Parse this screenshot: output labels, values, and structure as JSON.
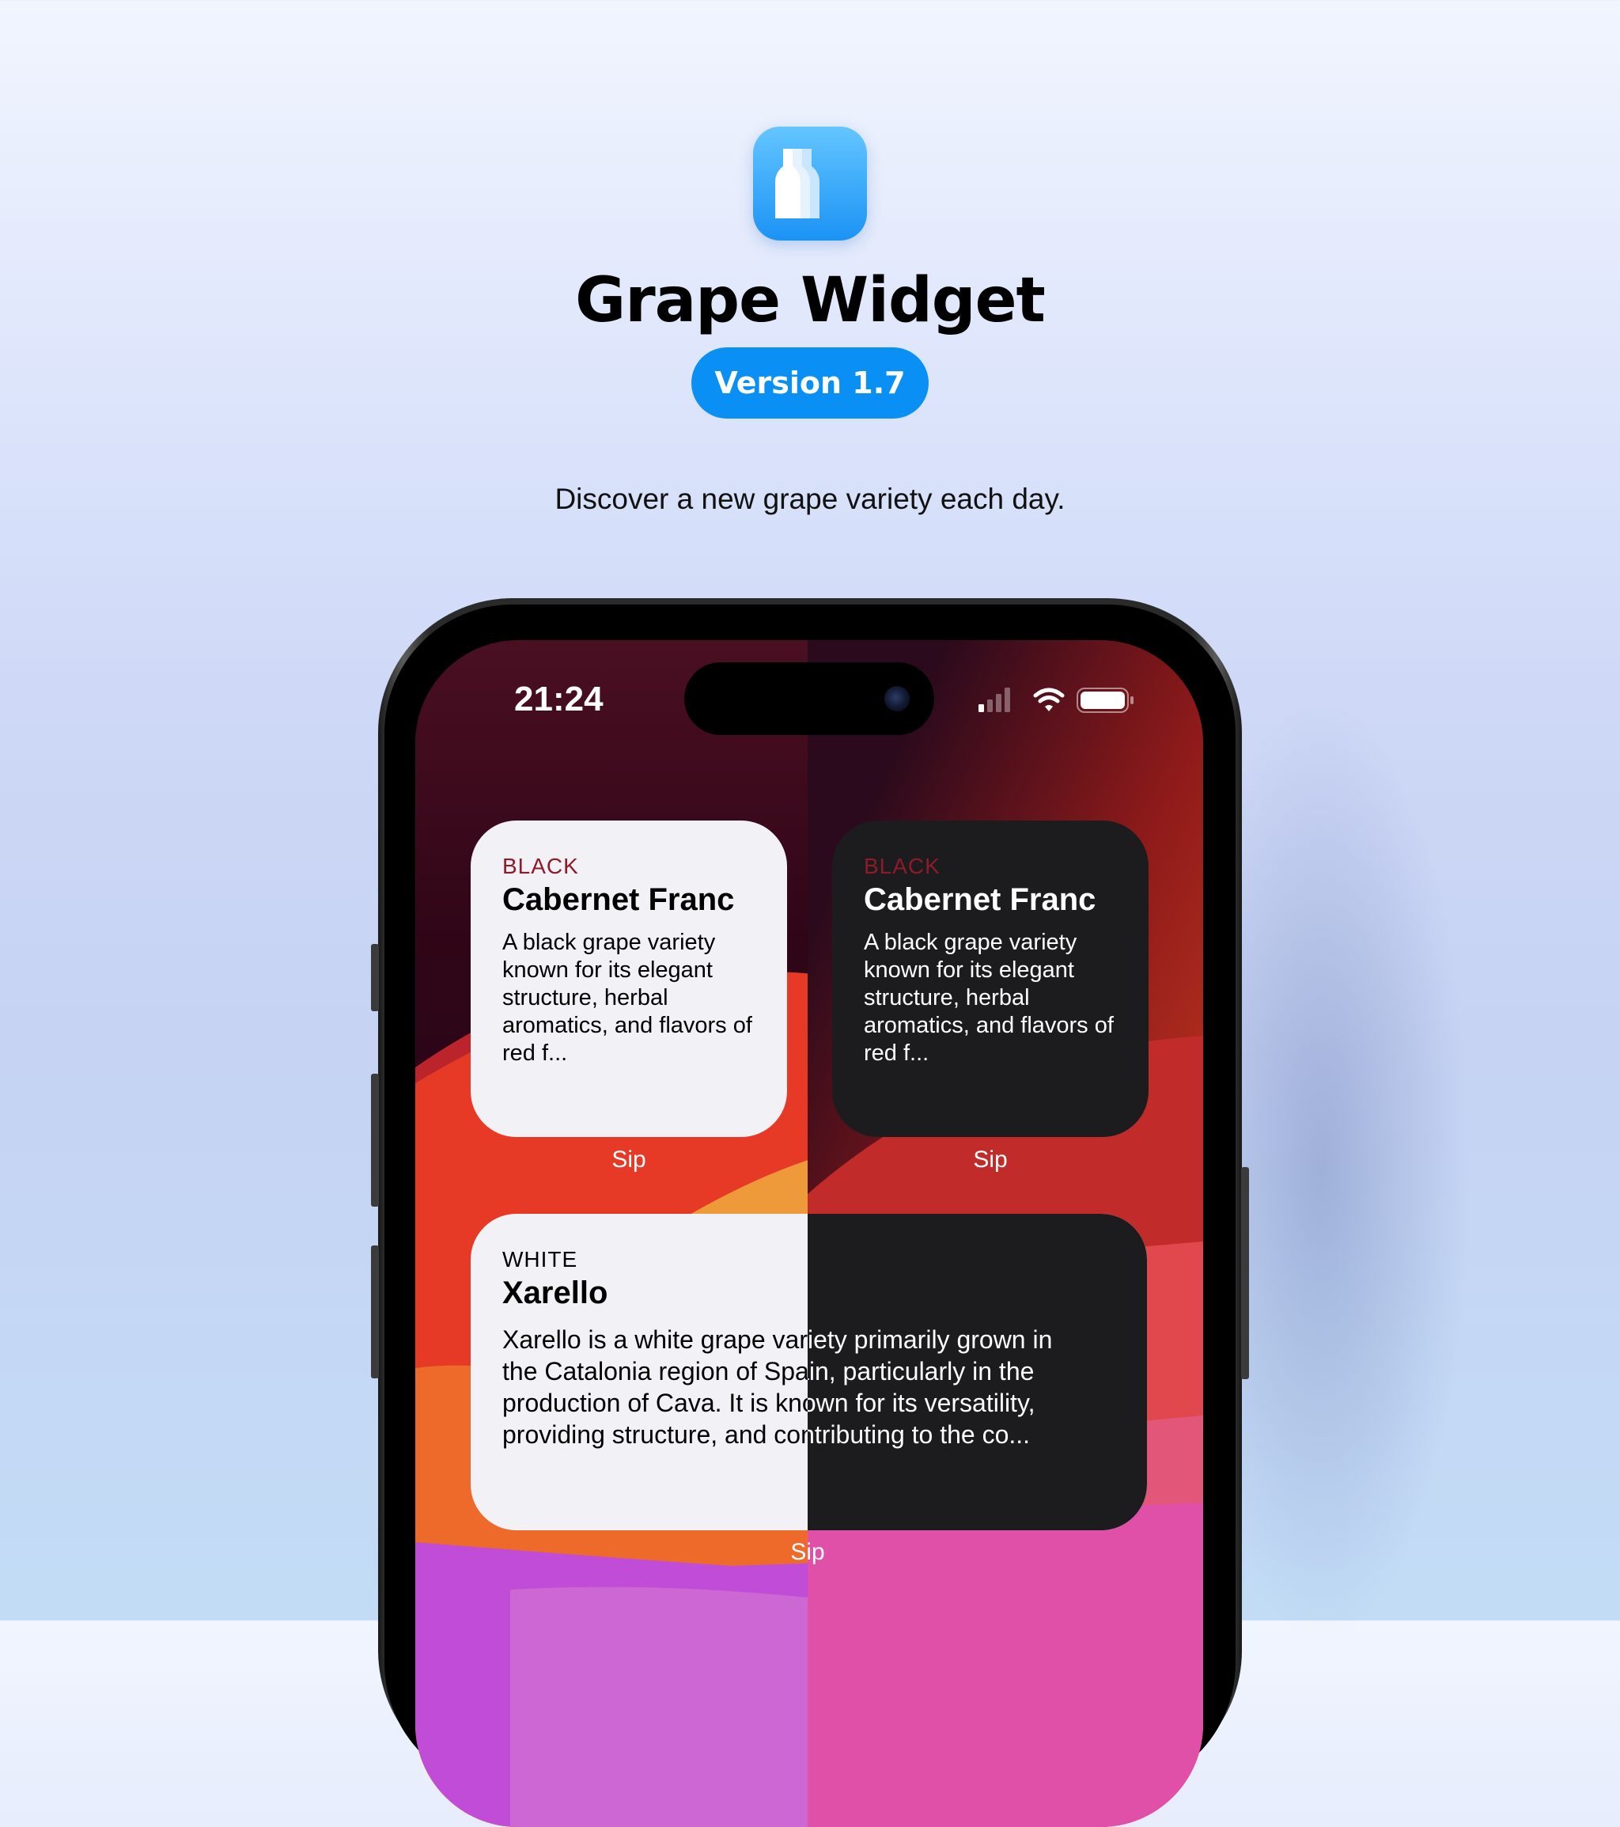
{
  "app": {
    "title": "Grape Widget",
    "version": "Version 1.7",
    "tagline": "Discover a new grape variety each day.",
    "icon": "wine-bottles-icon",
    "accent_color": "#0a8ff5"
  },
  "status_bar": {
    "time": "21:24",
    "icons": [
      "cellular-signal-icon",
      "wifi-icon",
      "battery-icon"
    ]
  },
  "widgets": {
    "small_light": {
      "category": "BLACK",
      "name": "Cabernet Franc",
      "description": "A black grape variety known for its elegant structure, herbal aromatics, and flavors of red f...",
      "app_label": "Sip"
    },
    "small_dark": {
      "category": "BLACK",
      "name": "Cabernet Franc",
      "description": "A black grape variety known for its elegant structure, herbal aromatics, and flavors of red f...",
      "app_label": "Sip"
    },
    "large": {
      "category": "WHITE",
      "name": "Xarello",
      "lines": [
        "Xarello is a white grape variety primarily grown in",
        "the Catalonia region of Spain, particularly in the",
        "production of Cava. It is known for its versatility,",
        "providing structure, and contributing to the co..."
      ],
      "app_label": "Sip"
    }
  },
  "colors": {
    "category_black": "#8e1a2a",
    "category_white": "#e6c12f",
    "widget_light_bg": "#f2f1f6",
    "widget_dark_bg": "#1c1c1f"
  }
}
